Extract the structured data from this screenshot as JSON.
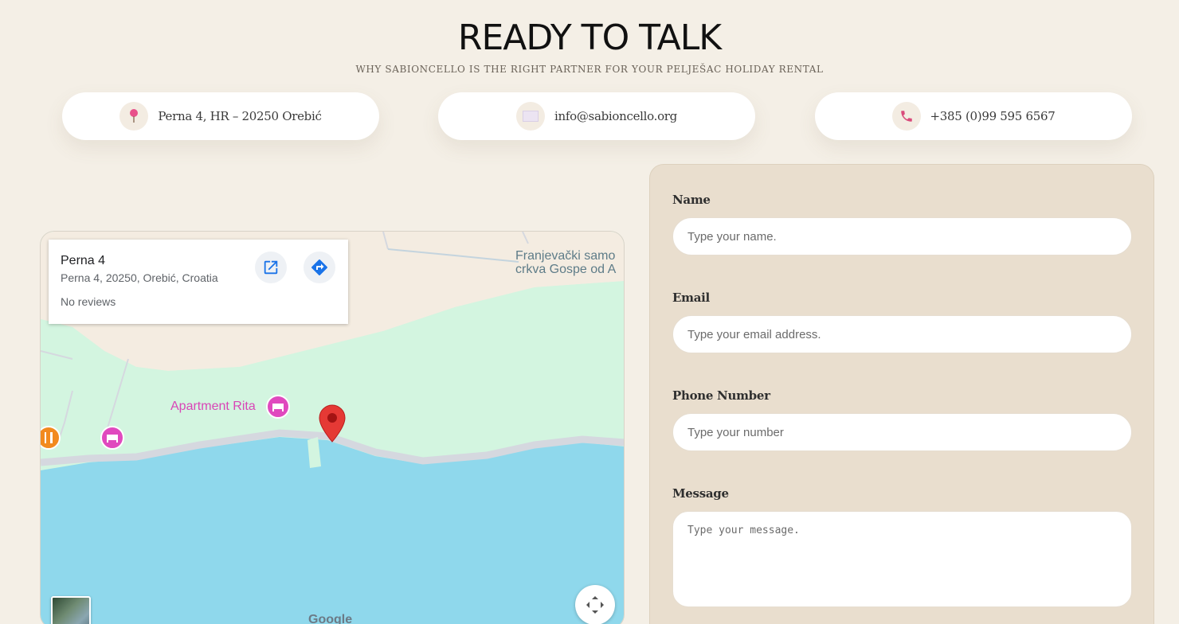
{
  "header": {
    "title": "READY TO TALK",
    "subtitle": "WHY SABIONCELLO IS THE RIGHT PARTNER FOR YOUR PELJEŠAC HOLIDAY RENTAL"
  },
  "contacts": [
    {
      "icon": "location-pin-icon",
      "text": "Perna 4, HR – 20250 Orebić"
    },
    {
      "icon": "envelope-icon",
      "text": "info@sabioncello.org"
    },
    {
      "icon": "phone-icon",
      "text": "+385 (0)99 595 6567"
    }
  ],
  "map": {
    "place_name": "Perna 4",
    "place_address": "Perna 4, 20250, Orebić, Croatia",
    "reviews": "No reviews",
    "poi_apartment": "Apartment Rita",
    "poi_church": "Franjevački samo\ncrkva Gospe od A",
    "attribution": "Google",
    "colors": {
      "water": "#8fd8ec",
      "park": "#d3f5e0",
      "land": "#f4ece1",
      "road": "#d5d8df",
      "marker": "#e53935"
    }
  },
  "form": {
    "name_label": "Name",
    "name_placeholder": "Type your name.",
    "email_label": "Email",
    "email_placeholder": "Type your email address.",
    "phone_label": "Phone Number",
    "phone_placeholder": "Type your number",
    "message_label": "Message",
    "message_placeholder": "Type your message."
  },
  "colors": {
    "accent": "#d94a7a",
    "background": "#f4efe6",
    "form_panel": "#e9dece"
  }
}
